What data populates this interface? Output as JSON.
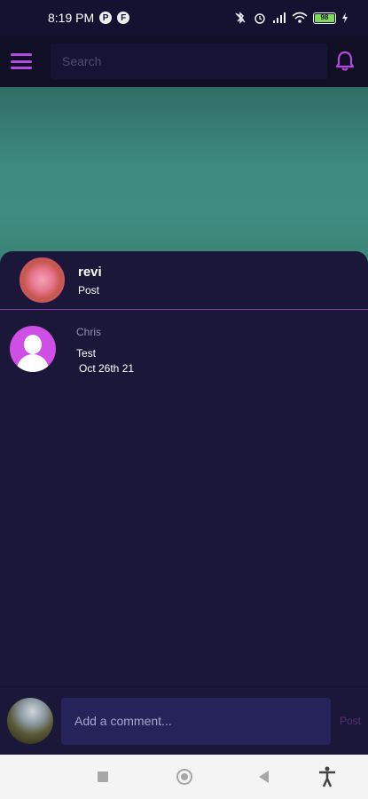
{
  "status_bar": {
    "time": "8:19 PM",
    "notification_icons": [
      "P",
      "F"
    ],
    "system_icons": [
      "bluetooth-off-icon",
      "alarm-icon",
      "signal-icon",
      "wifi-icon"
    ],
    "battery_level": "98"
  },
  "app_bar": {
    "search_placeholder": "Search",
    "accent_color": "#b44be0"
  },
  "post": {
    "username": "revi",
    "type": "Post"
  },
  "comments": [
    {
      "username": "Chris",
      "text": "Test",
      "date": "Oct 26th 21"
    }
  ],
  "comment_bar": {
    "placeholder": "Add a comment...",
    "post_label": "Post"
  },
  "nav_bar": {
    "buttons": [
      "recents-icon",
      "home-icon",
      "back-icon",
      "accessibility-icon"
    ]
  }
}
